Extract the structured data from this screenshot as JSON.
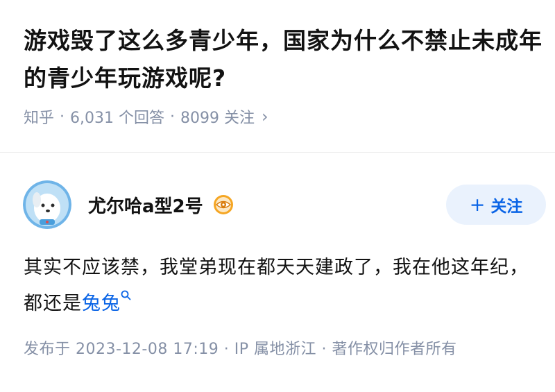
{
  "question": {
    "title": "游戏毁了这么多青少年，国家为什么不禁止未成年的青少年玩游戏呢?",
    "source": "知乎",
    "answers": "6,031 个回答",
    "followers": "8099 关注",
    "separator": "·",
    "chevron": "›"
  },
  "answer": {
    "author_name": "尤尔哈a型2号",
    "follow_plus": "+",
    "follow_label": "关注",
    "body_text": "其实不应该禁，我堂弟现在都天天建政了，我在他这年纪，都还是",
    "keyword_link": "兔兔",
    "footer": "发布于 2023-12-08 17:19 · IP 属地浙江 · 著作权归作者所有"
  },
  "colors": {
    "text": "#121212",
    "meta": "#8590a6",
    "accent": "#0a64e6",
    "follow_bg": "#eaf2fd"
  },
  "icons": {
    "avatar": "cartoon-dog-avatar",
    "badge": "eye-badge-icon",
    "keyword_search": "search-icon"
  }
}
